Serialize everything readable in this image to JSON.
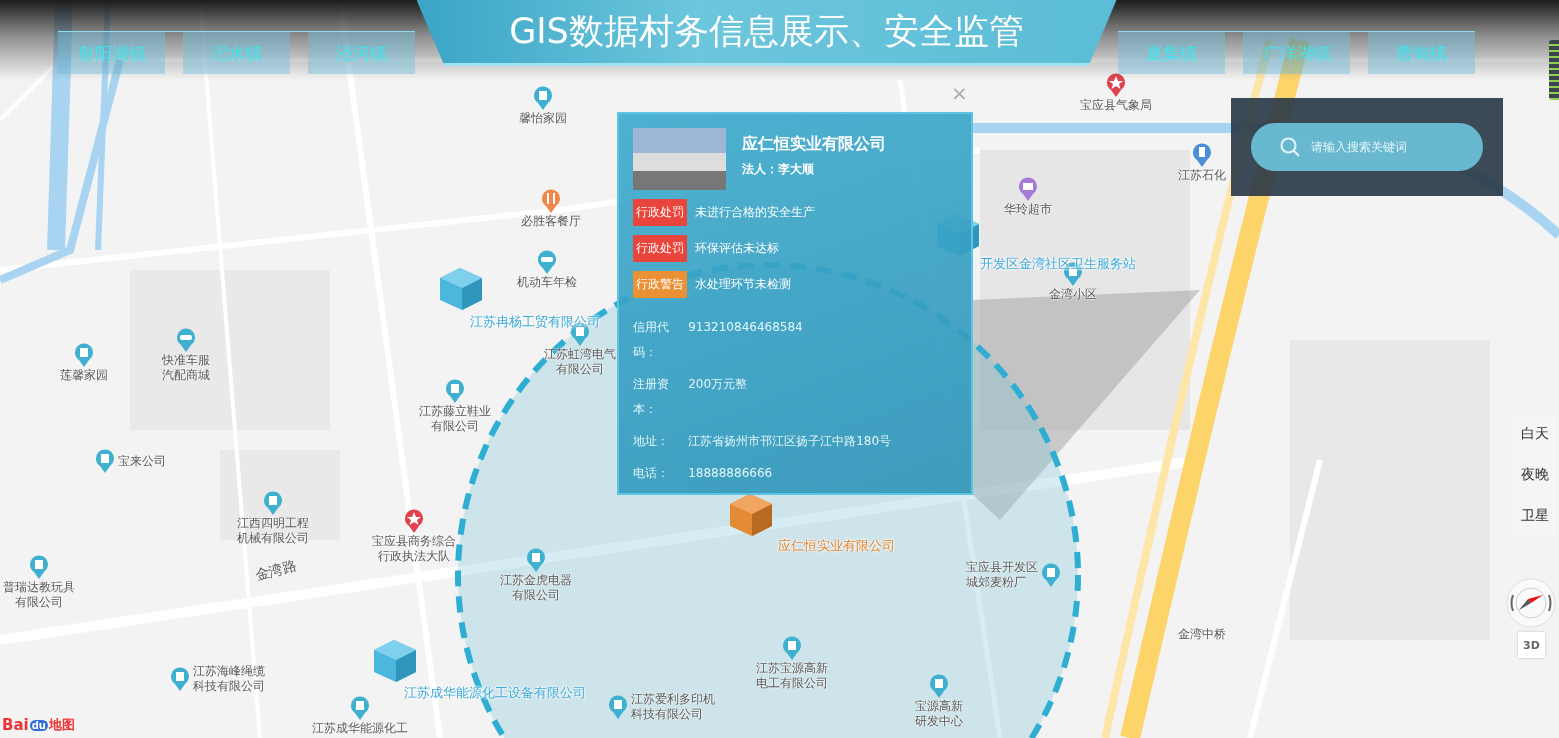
{
  "header": {
    "title": "GIS数据村务信息展示、安全监管",
    "left_towns": [
      "射阳湖镇",
      "汜水镇",
      "泾河镇"
    ],
    "right_towns": [
      "夏集镇",
      "广洋湖镇",
      "曹甸镇"
    ]
  },
  "map": {
    "pois": [
      {
        "name": "馨怡家园",
        "kind": "building"
      },
      {
        "name": "宝应县气象局",
        "kind": "star"
      },
      {
        "name": "必胜客餐厅",
        "kind": "food"
      },
      {
        "name": "华玲超市",
        "kind": "shop"
      },
      {
        "name": "江苏石化",
        "kind": "gas"
      },
      {
        "name": "机动车年检",
        "kind": "car"
      },
      {
        "name": "金湾小区",
        "kind": "building"
      },
      {
        "name": "莲馨家园",
        "kind": "building"
      },
      {
        "name": "快准车服汽配商城",
        "kind": "car"
      },
      {
        "name": "江苏虹湾电气有限公司",
        "kind": "building"
      },
      {
        "name": "江苏藤立鞋业有限公司",
        "kind": "building"
      },
      {
        "name": "宝来公司",
        "kind": "building"
      },
      {
        "name": "江西四明工程机械有限公司",
        "kind": "building"
      },
      {
        "name": "宝应县商务综合行政执法大队",
        "kind": "star"
      },
      {
        "name": "普瑞达教玩具有限公司",
        "kind": "building"
      },
      {
        "name": "江苏金虎电器有限公司",
        "kind": "building"
      },
      {
        "name": "宝应县开发区城郊麦粉厂",
        "kind": "building"
      },
      {
        "name": "江苏宝源高新电工有限公司",
        "kind": "building"
      },
      {
        "name": "金湾中桥",
        "kind": "label"
      },
      {
        "name": "江苏海峰绳缆科技有限公司",
        "kind": "building"
      },
      {
        "name": "江苏成华能源化工",
        "kind": "building"
      },
      {
        "name": "江苏爱利多印机科技有限公司",
        "kind": "building"
      },
      {
        "name": "宝源高新研发中心",
        "kind": "building"
      }
    ],
    "roads": [
      "金湾路"
    ],
    "companies": [
      {
        "name": "江苏冉杨工贸有限公司",
        "highlighted": false
      },
      {
        "name": "开发区金湾社区卫生服务站",
        "highlighted": false
      },
      {
        "name": "江苏成华能源化工设备有限公司",
        "highlighted": false
      },
      {
        "name": "应仁恒实业有限公司",
        "highlighted": true
      }
    ]
  },
  "popup": {
    "close": "×",
    "name": "应仁恒实业有限公司",
    "legal_person": "法人：李大顺",
    "records": [
      {
        "tag": "行政处罚",
        "text": "未进行合格的安全生产",
        "color": "#e8453c"
      },
      {
        "tag": "行政处罚",
        "text": "环保评估未达标",
        "color": "#e8453c"
      },
      {
        "tag": "行政警告",
        "text": "水处理环节未检测",
        "color": "#ec9035"
      }
    ],
    "fields": [
      {
        "label": "信用代码：",
        "value": "913210846468584"
      },
      {
        "label": "注册资本：",
        "value": "200万元整"
      },
      {
        "label": "地址：",
        "value": "江苏省扬州市邗江区扬子江中路180号"
      },
      {
        "label": "电话：",
        "value": "18888886666"
      }
    ]
  },
  "search": {
    "placeholder": "请输入搜索关键词"
  },
  "map_types": [
    "白天",
    "夜晚",
    "卫星"
  ],
  "view_toggle": "3D",
  "logo": {
    "latin": "Bai",
    "badge": "du",
    "cjk": "地图"
  }
}
